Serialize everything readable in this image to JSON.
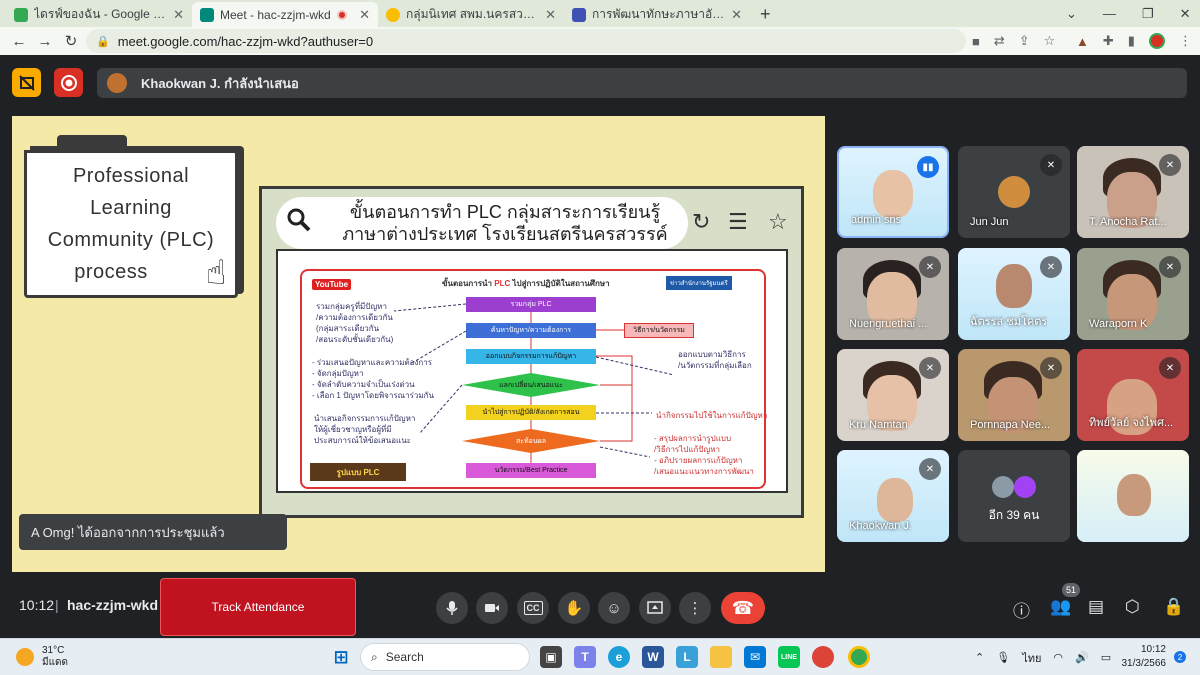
{
  "browser": {
    "tabs": [
      {
        "title": "ไดรฟ์ของฉัน - Google ไดรฟ์",
        "fav": "#34a853",
        "active": false
      },
      {
        "title": "Meet - hac-zzjm-wkd",
        "fav": "#00897b",
        "active": true
      },
      {
        "title": "กลุ่มนิเทศ สพม.นครสวรรค์",
        "fav": "#fbbc04",
        "active": false
      },
      {
        "title": "การพัฒนาทักษะภาษาอังกฤษ English",
        "fav": "#3f51b5",
        "active": false
      }
    ],
    "url": "meet.google.com/hac-zzjm-wkd?authuser=0"
  },
  "presenter": {
    "label": "Khaokwan J. กำลังนำเสนอ"
  },
  "slide": {
    "title_lines": [
      "Professional",
      "Learning",
      "Community (PLC)",
      "process"
    ],
    "search_line1": "ขั้นตอนการทำ PLC กลุ่มสาระการเรียนรู้",
    "search_line2": "ภาษาต่างประเทศ โรงเรียนสตรีนครสวรรค์",
    "infographic": {
      "youtube": "YouTube",
      "heading_prefix": "ขั้นตอนการนำ",
      "heading_plc": "PLC",
      "heading_suffix": "ไปสู่การปฏิบัติในสถานศึกษา",
      "agency": "ข่าวสำนักงานรัฐมนตรี",
      "steps": [
        "รวมกลุ่ม PLC",
        "ค้นหาปัญหา/ความต้องการ",
        "ออกแบบกิจกรรมการแก้ปัญหา",
        "แลกเปลี่ยน/เสนอแนะ",
        "นำไปสู่การปฏิบัติ/สังเกตการสอน",
        "สะท้อนผล",
        "นวัตกรรม/Best Practice"
      ],
      "side_box": "วิธีการ/นวัตกรรม",
      "left_notes_1": [
        "รวมกลุ่มครูที่มีปัญหา",
        "/ความต้องการเดียวกัน",
        "(กลุ่มสาระเดียวกัน",
        "/สอนระดับชั้นเดียวกัน)"
      ],
      "left_notes_2": [
        "- ร่วมเสนอปัญหาและความต้องการ",
        "- จัดกลุ่มปัญหา",
        "- จัดลำดับความจำเป็นเร่งด่วน",
        "- เลือก 1 ปัญหาโดยพิจารณาร่วมกัน"
      ],
      "left_notes_3": [
        "นำเสนอกิจกรรมการแก้ปัญหา",
        "ให้ผู้เชี่ยวชาญหรือผู้ที่มี",
        "ประสบการณ์ให้ข้อเสนอแนะ"
      ],
      "right_notes_1": [
        "ออกแบบตามวิธีการ",
        "/นวัตกรรมที่กลุ่มเลือก"
      ],
      "right_note_2": "นำกิจกรรมไปใช้ในการแก้ปัญหา",
      "right_notes_3": [
        "- สรุปผลการนำรูปแบบ",
        "/วิธีการไปแก้ปัญหา",
        "- อภิปรายผลการแก้ปัญหา",
        "/เสนอแนะแนวทางการพัฒนา"
      ],
      "bottom_logo": "รูปแบบ PLC"
    }
  },
  "toast": "A Omg! ได้ออกจากการประชุมแล้ว",
  "participants": [
    {
      "name": "admin sns",
      "kind": "slide"
    },
    {
      "name": "Jun Jun",
      "kind": "avatar"
    },
    {
      "name": "T. Anocha Rat...",
      "kind": "face"
    },
    {
      "name": "Nuengruethai ...",
      "kind": "face"
    },
    {
      "name": "ฉัตรรส ชมโคตร",
      "kind": "slide"
    },
    {
      "name": "Waraporn K",
      "kind": "face"
    },
    {
      "name": "Kru Namtan",
      "kind": "face"
    },
    {
      "name": "Pornnapa Nee...",
      "kind": "face"
    },
    {
      "name": "ทิพย์วัลย์ จงไพศ...",
      "kind": "face"
    },
    {
      "name": "Khaokwan J.",
      "kind": "slide"
    }
  ],
  "others": {
    "label": "อีก 39 คน"
  },
  "bottom": {
    "time": "10:12",
    "sep": "|",
    "code": "hac-zzjm-wkd",
    "track": "Track Attendance",
    "people_count": "51"
  },
  "taskbar": {
    "temp": "31°C",
    "weather": "มีแดด",
    "search": "Search",
    "lang": "ไทย",
    "time": "10:12",
    "date": "31/3/2566",
    "notifications": "2"
  },
  "colors": {
    "accent": "#8ab4f8",
    "end_call": "#ea4335",
    "track": "#c1121f"
  }
}
